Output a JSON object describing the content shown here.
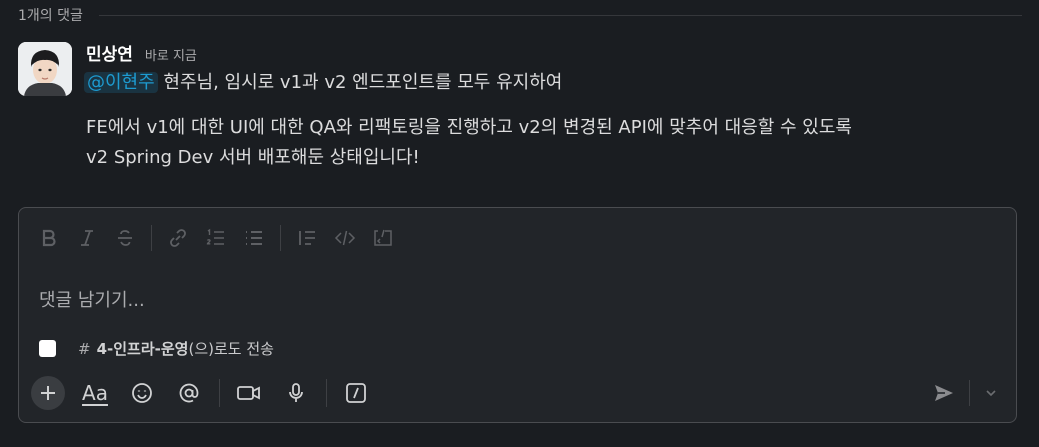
{
  "thread": {
    "reply_count_label": "1개의 댓글"
  },
  "message": {
    "author": "민상연",
    "time": "바로 지금",
    "mention": "@이현주",
    "line1": " 현주님, 임시로 v1과 v2 엔드포인트를 모두 유지하여",
    "line2": "FE에서 v1에 대한 UI에 대한 QA와 리팩토링을 진행하고 v2의 변경된 API에 맞추어 대응할 수 있도록",
    "line3": "v2 Spring Dev 서버 배포해둔 상태입니다!"
  },
  "composer": {
    "placeholder": "댓글 남기기...",
    "also_send": {
      "hash": "#",
      "channel": "4-인프라-운영",
      "suffix": "(으)로도 전송",
      "checked": false
    },
    "format_icons": [
      "bold-icon",
      "italic-icon",
      "strikethrough-icon",
      "link-icon",
      "ordered-list-icon",
      "bulleted-list-icon",
      "blockquote-icon",
      "code-icon",
      "code-block-icon"
    ],
    "tool_icons": [
      "plus-icon",
      "formatting-icon",
      "emoji-icon",
      "mention-icon",
      "video-icon",
      "microphone-icon",
      "slash-command-icon"
    ],
    "format_toggle_label": "Aa",
    "send_icon": "send-icon"
  },
  "colors": {
    "background": "#1a1d21",
    "mention": "#1d9bd1",
    "composer": "#222529"
  }
}
